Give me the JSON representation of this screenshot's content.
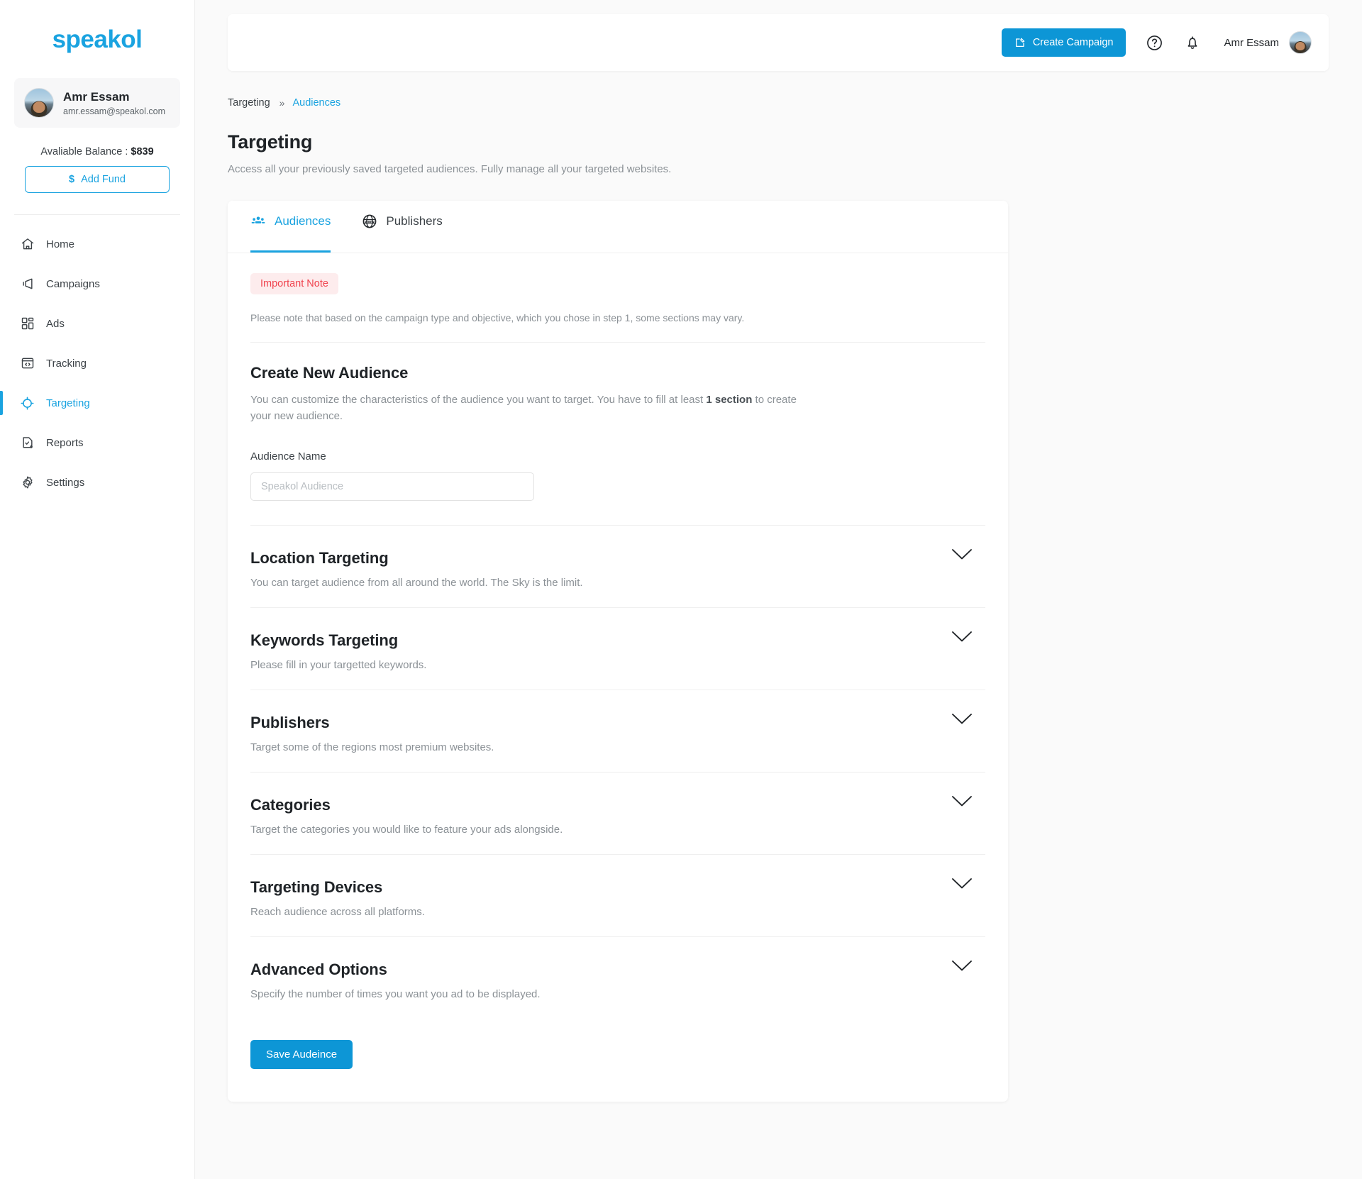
{
  "brand": {
    "name": "speakol",
    "accent": "#1aa3e0"
  },
  "sidebar": {
    "profile": {
      "name": "Amr Essam",
      "email": "amr.essam@speakol.com"
    },
    "balance": {
      "label": "Avaliable Balance :",
      "amount": "$839"
    },
    "add_fund": {
      "currency": "$",
      "label": "Add Fund"
    },
    "items": [
      {
        "label": "Home",
        "icon": "home-icon"
      },
      {
        "label": "Campaigns",
        "icon": "megaphone-icon"
      },
      {
        "label": "Ads",
        "icon": "grid-icon"
      },
      {
        "label": "Tracking",
        "icon": "code-window-icon"
      },
      {
        "label": "Targeting",
        "icon": "target-icon"
      },
      {
        "label": "Reports",
        "icon": "report-download-icon"
      },
      {
        "label": "Settings",
        "icon": "gear-icon"
      }
    ]
  },
  "topbar": {
    "create_campaign": "Create Campaign",
    "help_icon": "question-circle-icon",
    "notifications_icon": "bell-icon",
    "username": "Amr Essam"
  },
  "breadcrumb": {
    "parent": "Targeting",
    "separator": "»",
    "current": "Audiences"
  },
  "page": {
    "title": "Targeting",
    "subtitle": "Access all your previously saved targeted audiences. Fully manage all your targeted websites."
  },
  "tabs": [
    {
      "label": "Audiences",
      "icon": "people-group-icon",
      "active": true
    },
    {
      "label": "Publishers",
      "icon": "www-globe-icon",
      "active": false
    }
  ],
  "note": {
    "badge": "Important Note",
    "text": "Please note that based on the campaign type and objective, which you chose in step 1, some sections may vary."
  },
  "create_audience": {
    "title": "Create New Audience",
    "desc_before": "You can customize the characteristics of the audience you want to target. You have to fill at least ",
    "desc_bold": "1 section",
    "desc_after": " to create your new audience.",
    "field_label": "Audience Name",
    "field_value": "",
    "field_placeholder": "Speakol Audience"
  },
  "sections": [
    {
      "title": "Location Targeting",
      "desc": "You can target audience from all around the world. The Sky is the limit.",
      "icon": "chevron-down-icon"
    },
    {
      "title": "Keywords Targeting",
      "desc": "Please fill in your targetted keywords.",
      "icon": "chevron-down-icon"
    },
    {
      "title": "Publishers",
      "desc": "Target some of the regions most premium websites.",
      "icon": "chevron-down-icon"
    },
    {
      "title": "Categories",
      "desc": "Target the categories you would like to feature your ads alongside.",
      "icon": "chevron-down-icon"
    },
    {
      "title": "Targeting Devices",
      "desc": "Reach audience across all platforms.",
      "icon": "chevron-down-icon"
    },
    {
      "title": "Advanced Options",
      "desc": "Specify the number of times you want you ad to be displayed.",
      "icon": "chevron-down-icon"
    }
  ],
  "save_button": "Save Audeince"
}
